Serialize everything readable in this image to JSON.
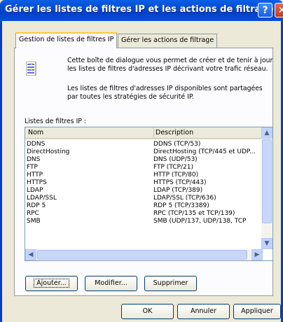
{
  "window": {
    "title": "Gérer les listes de filtres IP et les actions de filtrage",
    "help_glyph": "?",
    "close_glyph": "✕"
  },
  "tabs": [
    {
      "label": "Gestion de listes de filtres IP"
    },
    {
      "label": "Gérer les actions de filtrage"
    }
  ],
  "intro": {
    "line1": "Cette boîte de dialogue vous permet de créer et de tenir à jour",
    "line2": "les listes de filtres d'adresses IP décrivant votre trafic réseau.",
    "line3": "Les listes de filtres d'adresses IP disponibles sont partagées",
    "line4": "par toutes les stratégies de sécurité IP."
  },
  "list": {
    "label": "Listes de filtres IP :",
    "columns": [
      "Nom",
      "Description"
    ],
    "rows": [
      [
        "DDNS",
        "DDNS (TCP/53)"
      ],
      [
        "DirectHosting",
        "DirectHosting (TCP/445 et UDP..."
      ],
      [
        "DNS",
        "DNS (UDP/53)"
      ],
      [
        "FTP",
        "FTP (TCP/21)"
      ],
      [
        "HTTP",
        "HTTP (TCP/80)"
      ],
      [
        "HTTPS",
        "HTTPS (TCP/443)"
      ],
      [
        "LDAP",
        "LDAP (TCP/389)"
      ],
      [
        "LDAP/SSL",
        "LDAP/SSL (TCP/636)"
      ],
      [
        "RDP 5",
        "RDP 5 (TCP/3389)"
      ],
      [
        "RPC",
        "RPC (TCP/135 et TCP/139)"
      ],
      [
        "SMB",
        "SMB (UDP/137, UDP/138, TCP"
      ]
    ]
  },
  "buttons": {
    "add": "Ajouter...",
    "modify": "Modifier...",
    "delete": "Supprimer"
  },
  "footer": {
    "ok": "OK",
    "cancel": "Annuler",
    "apply": "Appliquer"
  },
  "scroll": {
    "up": "▲",
    "down": "▼",
    "left": "◀",
    "right": "▶"
  },
  "colors": {
    "title_bar": "#0040c8",
    "dialog": "#ece9d8"
  }
}
